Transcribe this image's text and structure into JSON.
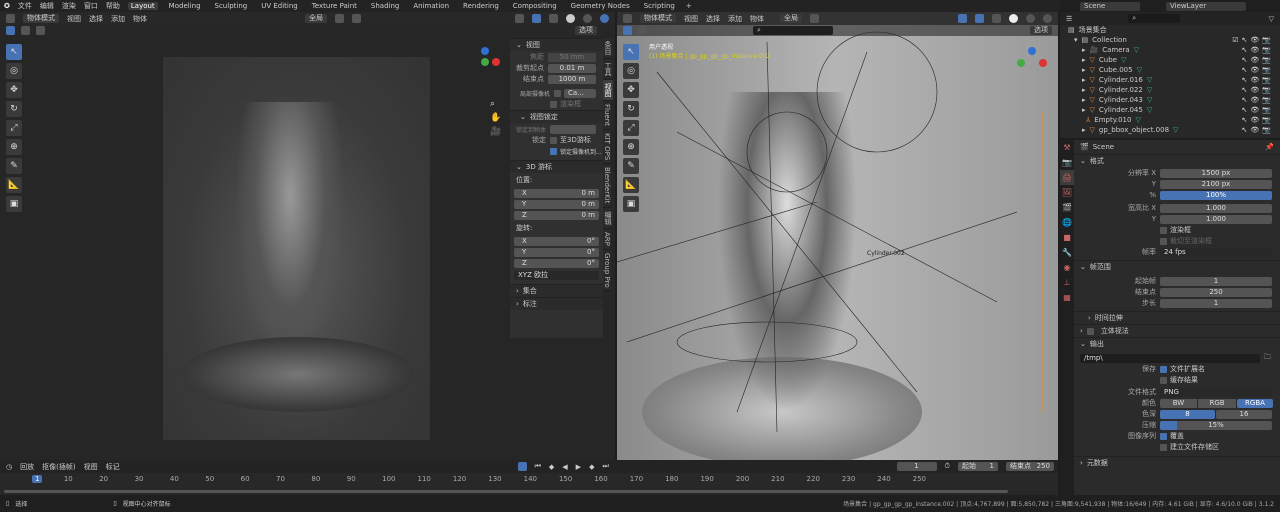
{
  "menubar": {
    "items": [
      "文件",
      "编辑",
      "渲染",
      "窗口",
      "帮助"
    ],
    "workspaces": [
      "Layout",
      "Modeling",
      "Sculpting",
      "UV Editing",
      "Texture Paint",
      "Shading",
      "Animation",
      "Rendering",
      "Compositing",
      "Geometry Nodes",
      "Scripting"
    ],
    "active": "Layout",
    "add": "+"
  },
  "left_viewport": {
    "mode": "物体模式",
    "menus": [
      "视图",
      "选择",
      "添加",
      "物体"
    ],
    "transform": "全局",
    "options": "选项"
  },
  "npanel": {
    "view_section": "视图",
    "focal_label": "焦距",
    "focal": "50 mm",
    "clip_start_label": "裁剪起点",
    "clip_start": "0.01 m",
    "clip_end_label": "结束点",
    "clip_end": "1000 m",
    "local_camera_label": "局部摄像机",
    "local_camera": "Ca...",
    "render_region": "渲染框",
    "view_lock_section": "视图锁定",
    "lock_to_object": "锁定到物体",
    "lock_label": "锁定",
    "to_3d_cursor": "至3D游标",
    "camera_to_view": "锁定摄像机到...",
    "cursor_section": "3D 游标",
    "location_label": "位置:",
    "loc": [
      {
        "axis": "X",
        "value": "0 m"
      },
      {
        "axis": "Y",
        "value": "0 m"
      },
      {
        "axis": "Z",
        "value": "0 m"
      }
    ],
    "rotation_label": "旋转:",
    "rot": [
      {
        "axis": "X",
        "value": "0°"
      },
      {
        "axis": "Y",
        "value": "0°"
      },
      {
        "axis": "Z",
        "value": "0°"
      }
    ],
    "rotation_mode": "XYZ 欧拉",
    "collections_section": "集合",
    "annotations_section": "标注",
    "tabs": [
      "条目",
      "工具",
      "视图",
      "Fluent",
      "KIT OPS",
      "BlenderKit",
      "编辑",
      "ARP",
      "Group Pro"
    ]
  },
  "right_viewport": {
    "mode": "物体模式",
    "menus": [
      "视图",
      "选择",
      "添加",
      "物体"
    ],
    "transform": "全局",
    "options": "选项",
    "overlay_title": "用户透视",
    "overlay_sub": "(1) 场景集合 | gp_gp_gp_gp_instance.002",
    "label_in_scene": "Cylinder.002"
  },
  "outliner": {
    "scene": "Scene",
    "view_layer": "ViewLayer",
    "root": "场景集合",
    "collection": "Collection",
    "items": [
      "Camera",
      "Cube",
      "Cube.005",
      "Cylinder.016",
      "Cylinder.022",
      "Cylinder.043",
      "Cylinder.045",
      "Empty.010",
      "gp_bbox_object.008"
    ]
  },
  "properties": {
    "scene": "Scene",
    "format_section": "格式",
    "res_x_label": "分辨率 X",
    "res_x": "1500 px",
    "res_y_label": "Y",
    "res_y": "2100 px",
    "pct_label": "%",
    "pct": "100%",
    "aspect_x_label": "宽高比 X",
    "aspect_x": "1.000",
    "aspect_y_label": "Y",
    "aspect_y": "1.000",
    "render_region": "渲染框",
    "crop": "裁切至渲染框",
    "fps_label": "帧率",
    "fps": "24 fps",
    "frame_range_section": "帧范围",
    "start_label": "起始帧",
    "start": "1",
    "end_label": "结束点",
    "end": "250",
    "step_label": "步长",
    "step": "1",
    "time_stretch": "时间拉伸",
    "stereoscopy": "立体视法",
    "output_section": "输出",
    "path": "/tmp\\",
    "save_label": "保存",
    "file_ext": "文件扩展名",
    "cache_result": "缓存结果",
    "format_label": "文件格式",
    "format": "PNG",
    "color_label": "颜色",
    "color_opts": [
      "BW",
      "RGB",
      "RGBA"
    ],
    "depth_label": "色深",
    "depth_opts": [
      "8",
      "16"
    ],
    "compression_label": "压缩",
    "compression": "15%",
    "compression_fraction": 0.15,
    "seq_label": "图像序列",
    "overwrite": "覆盖",
    "placeholders": "建立文件存储区",
    "metadata": "元数据"
  },
  "timeline": {
    "menus": [
      "回放",
      "抠像(插帧)",
      "视图",
      "标记"
    ],
    "current": "1",
    "start_label": "起始",
    "start": "1",
    "end_label": "结束点",
    "end": "250",
    "ticks": [
      "1",
      "10",
      "20",
      "30",
      "40",
      "50",
      "60",
      "70",
      "80",
      "90",
      "100",
      "110",
      "120",
      "130",
      "140",
      "150",
      "160",
      "170",
      "180",
      "190",
      "200",
      "210",
      "220",
      "230",
      "240",
      "250"
    ]
  },
  "statusbar": {
    "select": "选择",
    "center": "视图中心对齐鼠标",
    "stats": "场景集合 | gp_gp_gp_gp_instance.002 | 顶点:4,767,899 | 面:5,850,782 | 三角面:9,541,938 | 物体:16/649 | 内存: 4.61 GiB | 显存: 4.6/10.0 GiB | 3.1.2"
  }
}
